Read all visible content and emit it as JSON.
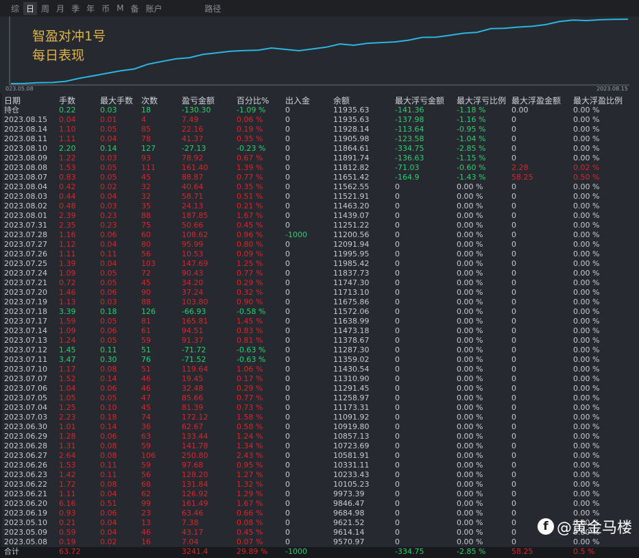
{
  "tabs": [
    "综",
    "日",
    "周",
    "月",
    "季",
    "年",
    "币",
    "M",
    "备",
    "账户",
    "路径"
  ],
  "selected_tab": 1,
  "chart": {
    "title": "智盈对冲1号",
    "subtitle": "每日表现",
    "start_label": "023.05.08",
    "end_label": "2023.08.15",
    "line_color": "#29b6e0"
  },
  "columns": [
    "日期",
    "手数",
    "最大手数",
    "次数",
    "盈亏金额",
    "百分比%",
    "出入金",
    "余额",
    "最大浮亏金额",
    "最大浮亏比例",
    "最大浮盈金额",
    "最大浮盈比例"
  ],
  "holding": [
    "持仓",
    "0.22",
    "0.03",
    "18",
    "-130.30",
    "-1.09 %",
    "0",
    "11935.63",
    "-141.36",
    "-1.18 %",
    "0.00",
    "0.00 %"
  ],
  "rows": [
    [
      "2023.08.15",
      "0.04",
      "0.01",
      "4",
      "7.49",
      "0.06 %",
      "0",
      "11935.63",
      "-137.98",
      "-1.16 %",
      "0",
      "0.00 %"
    ],
    [
      "2023.08.14",
      "1.10",
      "0.05",
      "85",
      "22.16",
      "0.19 %",
      "0",
      "11928.14",
      "-113.64",
      "-0.95 %",
      "0",
      "0.00 %"
    ],
    [
      "2023.08.11",
      "1.11",
      "0.04",
      "78",
      "41.37",
      "0.35 %",
      "0",
      "11905.98",
      "-123.58",
      "-1.04 %",
      "0",
      "0.00 %"
    ],
    [
      "2023.08.10",
      "2.20",
      "0.14",
      "127",
      "-27.13",
      "-0.23 %",
      "0",
      "11864.61",
      "-334.75",
      "-2.85 %",
      "0",
      "0.00 %"
    ],
    [
      "2023.08.09",
      "1.22",
      "0.03",
      "93",
      "78.92",
      "0.67 %",
      "0",
      "11891.74",
      "-136.63",
      "-1.15 %",
      "0",
      "0.00 %"
    ],
    [
      "2023.08.08",
      "1.53",
      "0.05",
      "111",
      "161.40",
      "1.39 %",
      "0",
      "11812.82",
      "-71.03",
      "-0.60 %",
      "2.28",
      "0.02 %"
    ],
    [
      "2023.08.07",
      "0.83",
      "0.05",
      "45",
      "88.87",
      "0.77 %",
      "0",
      "11651.42",
      "-164.9",
      "-1.43 %",
      "58.25",
      "0.50 %"
    ],
    [
      "2023.08.04",
      "0.42",
      "0.02",
      "32",
      "40.64",
      "0.35 %",
      "0",
      "11562.55",
      "0",
      "0.00 %",
      "0",
      "0.00 %"
    ],
    [
      "2023.08.03",
      "0.44",
      "0.04",
      "32",
      "58.71",
      "0.51 %",
      "0",
      "11521.91",
      "0",
      "0.00 %",
      "0",
      "0.00 %"
    ],
    [
      "2023.08.02",
      "0.48",
      "0.03",
      "35",
      "24.13",
      "0.21 %",
      "0",
      "11463.20",
      "0",
      "0.00 %",
      "0",
      "0.00 %"
    ],
    [
      "2023.08.01",
      "2.39",
      "0.23",
      "88",
      "187.85",
      "1.67 %",
      "0",
      "11439.07",
      "0",
      "0.00 %",
      "0",
      "0.00 %"
    ],
    [
      "2023.07.31",
      "2.35",
      "0.23",
      "75",
      "50.66",
      "0.45 %",
      "0",
      "11251.22",
      "0",
      "0.00 %",
      "0",
      "0.00 %"
    ],
    [
      "2023.07.28",
      "1.16",
      "0.06",
      "60",
      "108.62",
      "0.96 %",
      "-1000",
      "11200.56",
      "0",
      "0.00 %",
      "0",
      "0.00 %"
    ],
    [
      "2023.07.27",
      "1.12",
      "0.04",
      "80",
      "95.99",
      "0.80 %",
      "0",
      "12091.94",
      "0",
      "0.00 %",
      "0",
      "0.00 %"
    ],
    [
      "2023.07.26",
      "1.11",
      "0.11",
      "56",
      "10.53",
      "0.09 %",
      "0",
      "11995.95",
      "0",
      "0.00 %",
      "0",
      "0.00 %"
    ],
    [
      "2023.07.25",
      "1.39",
      "0.04",
      "103",
      "147.69",
      "1.25 %",
      "0",
      "11985.42",
      "0",
      "0.00 %",
      "0",
      "0.00 %"
    ],
    [
      "2023.07.24",
      "1.09",
      "0.05",
      "72",
      "90.43",
      "0.77 %",
      "0",
      "11837.73",
      "0",
      "0.00 %",
      "0",
      "0.00 %"
    ],
    [
      "2023.07.21",
      "0.72",
      "0.05",
      "45",
      "34.20",
      "0.29 %",
      "0",
      "11747.30",
      "0",
      "0.00 %",
      "0",
      "0.00 %"
    ],
    [
      "2023.07.20",
      "1.46",
      "0.06",
      "90",
      "37.24",
      "0.32 %",
      "0",
      "11713.10",
      "0",
      "0.00 %",
      "0",
      "0.00 %"
    ],
    [
      "2023.07.19",
      "1.13",
      "0.03",
      "88",
      "103.80",
      "0.90 %",
      "0",
      "11675.86",
      "0",
      "0.00 %",
      "0",
      "0.00 %"
    ],
    [
      "2023.07.18",
      "3.39",
      "0.18",
      "126",
      "-66.93",
      "-0.58 %",
      "0",
      "11572.06",
      "0",
      "0.00 %",
      "0",
      "0.00 %"
    ],
    [
      "2023.07.17",
      "1.59",
      "0.05",
      "81",
      "165.81",
      "1.45 %",
      "0",
      "11638.99",
      "0",
      "0.00 %",
      "0",
      "0.00 %"
    ],
    [
      "2023.07.14",
      "1.09",
      "0.06",
      "61",
      "94.51",
      "0.83 %",
      "0",
      "11473.18",
      "0",
      "0.00 %",
      "0",
      "0.00 %"
    ],
    [
      "2023.07.13",
      "1.24",
      "0.05",
      "59",
      "91.37",
      "0.81 %",
      "0",
      "11378.67",
      "0",
      "0.00 %",
      "0",
      "0.00 %"
    ],
    [
      "2023.07.12",
      "1.45",
      "0.11",
      "51",
      "-71.72",
      "-0.63 %",
      "0",
      "11287.30",
      "0",
      "0.00 %",
      "0",
      "0.00 %"
    ],
    [
      "2023.07.11",
      "3.47",
      "0.30",
      "76",
      "-71.52",
      "-0.63 %",
      "0",
      "11359.02",
      "0",
      "0.00 %",
      "0",
      "0.00 %"
    ],
    [
      "2023.07.10",
      "1.17",
      "0.08",
      "51",
      "119.64",
      "1.06 %",
      "0",
      "11430.54",
      "0",
      "0.00 %",
      "0",
      "0.00 %"
    ],
    [
      "2023.07.07",
      "1.52",
      "0.14",
      "46",
      "19.45",
      "0.17 %",
      "0",
      "11310.90",
      "0",
      "0.00 %",
      "0",
      "0.00 %"
    ],
    [
      "2023.07.06",
      "1.04",
      "0.06",
      "46",
      "32.48",
      "0.29 %",
      "0",
      "11291.45",
      "0",
      "0.00 %",
      "0",
      "0.00 %"
    ],
    [
      "2023.07.05",
      "1.05",
      "0.05",
      "47",
      "85.66",
      "0.77 %",
      "0",
      "11258.97",
      "0",
      "0.00 %",
      "0",
      "0.00 %"
    ],
    [
      "2023.07.04",
      "1.25",
      "0.10",
      "45",
      "81.39",
      "0.73 %",
      "0",
      "11173.31",
      "0",
      "0.00 %",
      "0",
      "0.00 %"
    ],
    [
      "2023.07.03",
      "2.23",
      "0.18",
      "74",
      "172.12",
      "1.58 %",
      "0",
      "11091.92",
      "0",
      "0.00 %",
      "0",
      "0.00 %"
    ],
    [
      "2023.06.30",
      "1.01",
      "0.14",
      "36",
      "62.67",
      "0.58 %",
      "0",
      "10919.80",
      "0",
      "0.00 %",
      "0",
      "0.00 %"
    ],
    [
      "2023.06.29",
      "1.28",
      "0.06",
      "63",
      "133.44",
      "1.24 %",
      "0",
      "10857.13",
      "0",
      "0.00 %",
      "0",
      "0.00 %"
    ],
    [
      "2023.06.28",
      "1.31",
      "0.08",
      "59",
      "141.78",
      "1.34 %",
      "0",
      "10723.69",
      "0",
      "0.00 %",
      "0",
      "0.00 %"
    ],
    [
      "2023.06.27",
      "2.64",
      "0.08",
      "106",
      "250.80",
      "2.43 %",
      "0",
      "10581.91",
      "0",
      "0.00 %",
      "0",
      "0.00 %"
    ],
    [
      "2023.06.26",
      "1.53",
      "0.11",
      "59",
      "97.68",
      "0.95 %",
      "0",
      "10331.11",
      "0",
      "0.00 %",
      "0",
      "0.00 %"
    ],
    [
      "2023.06.23",
      "1.42",
      "0.11",
      "56",
      "128.20",
      "1.27 %",
      "0",
      "10233.43",
      "0",
      "0.00 %",
      "0",
      "0.00 %"
    ],
    [
      "2023.06.22",
      "1.72",
      "0.08",
      "68",
      "131.84",
      "1.32 %",
      "0",
      "10105.23",
      "0",
      "0.00 %",
      "0",
      "0.00 %"
    ],
    [
      "2023.06.21",
      "1.11",
      "0.04",
      "62",
      "126.92",
      "1.29 %",
      "0",
      "9973.39",
      "0",
      "0.00 %",
      "0",
      "0.00 %"
    ],
    [
      "2023.06.20",
      "6.16",
      "0.51",
      "99",
      "161.49",
      "1.67 %",
      "0",
      "9846.47",
      "0",
      "0.00 %",
      "0",
      "0.00 %"
    ],
    [
      "2023.06.19",
      "0.93",
      "0.06",
      "23",
      "63.46",
      "0.66 %",
      "0",
      "9684.98",
      "0",
      "0.00 %",
      "0",
      "0.00 %"
    ],
    [
      "2023.05.10",
      "0.21",
      "0.04",
      "13",
      "7.38",
      "0.08 %",
      "0",
      "9621.52",
      "0",
      "0.00 %",
      "0",
      "0.00 %"
    ],
    [
      "2023.05.09",
      "0.59",
      "0.04",
      "46",
      "43.17",
      "0.45 %",
      "0",
      "9614.14",
      "0",
      "0.00 %",
      "0",
      "0.00 %"
    ],
    [
      "2023.05.08",
      "0.19",
      "0.02",
      "16",
      "7.04",
      "0.07 %",
      "0",
      "9570.97",
      "0",
      "0.00 %",
      "0",
      "0.00 %"
    ]
  ],
  "total": [
    "合计",
    "63.72",
    "",
    "",
    "3241.4",
    "29.89 %",
    "-1000",
    "",
    "-334.75",
    "-2.85 %",
    "58.25",
    "0.5 %"
  ],
  "watermark": {
    "text": "@黄金马楼",
    "icon": "facebook-f-icon",
    "icon_glyph": "f"
  }
}
